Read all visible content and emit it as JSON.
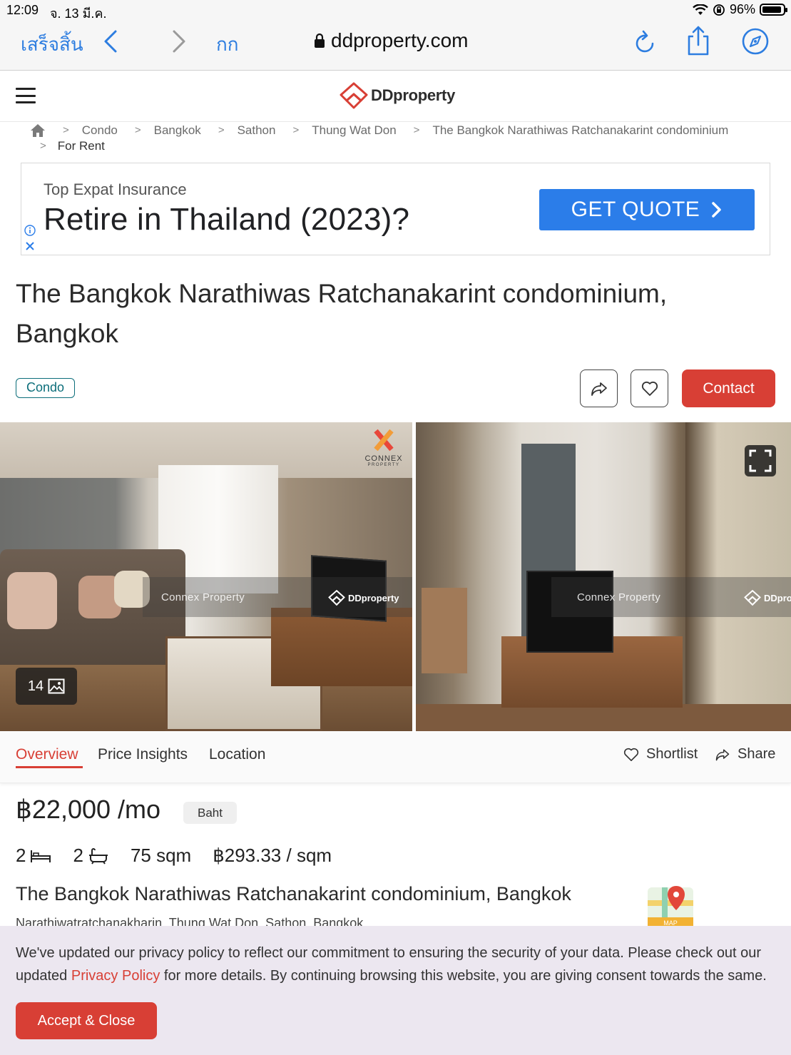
{
  "status_bar": {
    "time": "12:09",
    "date": "จ. 13 มี.ค.",
    "battery": "96%"
  },
  "browser": {
    "done_label": "เสร็จสิ้น",
    "text_size_label": "กก",
    "url": "ddproperty.com"
  },
  "site": {
    "logo_text": "DDproperty"
  },
  "breadcrumb": {
    "items": [
      "Condo",
      "Bangkok",
      "Sathon",
      "Thung Wat Don",
      "The Bangkok Narathiwas Ratchanakarint condominium"
    ],
    "current": "For Rent"
  },
  "ad": {
    "sponsor": "Top Expat Insurance",
    "headline": "Retire in Thailand (2023)?",
    "cta": "GET QUOTE"
  },
  "listing": {
    "title": "The Bangkok Narathiwas Ratchanakarint condominium, Bangkok",
    "tag": "Condo",
    "contact_label": "Contact",
    "photo_count": "14",
    "watermark_text": "Connex Property",
    "watermark_logo": "DDproperty",
    "watermark_logo_partial": "DDpro",
    "connex_logo": "CONNEX",
    "connex_sub": "PROPERTY"
  },
  "tabs": {
    "items": [
      "Overview",
      "Price Insights",
      "Location"
    ],
    "shortlist_label": "Shortlist",
    "share_label": "Share"
  },
  "details": {
    "price": "฿22,000 /mo",
    "currency": "Baht",
    "bedrooms": "2",
    "bathrooms": "2",
    "area": "75 sqm",
    "price_per_sqm": "฿293.33 / sqm",
    "subtitle": "The Bangkok Narathiwas Ratchanakarint condominium, Bangkok",
    "address": "Narathiwatratchanakharin, Thung Wat Don, Sathon, Bangkok",
    "map_label": "MAP"
  },
  "privacy": {
    "text_before": "We've updated our privacy policy to reflect our commitment to ensuring the security of your data. Please check out our updated ",
    "link_text": "Privacy Policy",
    "text_after": " for more details. By continuing browsing this website, you are giving consent towards the same.",
    "accept_label": "Accept & Close"
  },
  "colors": {
    "brand_red": "#d83f35",
    "ios_blue": "#2d7de0",
    "ad_blue": "#2b7de9",
    "tag_teal": "#0c6e7a"
  }
}
